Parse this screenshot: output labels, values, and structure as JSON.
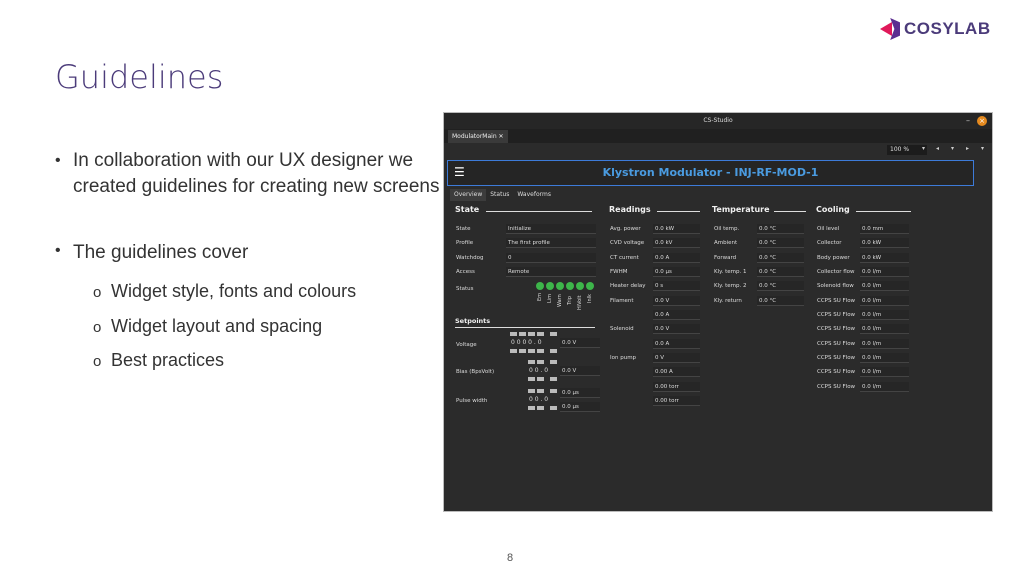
{
  "slide": {
    "title": "Guidelines",
    "logo_text": "COSYLAB",
    "page_number": "8",
    "bullets": [
      {
        "text": "In collaboration with our UX designer we created guidelines for creating new screens"
      },
      {
        "text": "The guidelines cover",
        "subs": [
          "Widget style, fonts and colours",
          "Widget layout and spacing",
          "Best practices"
        ]
      }
    ],
    "bullet_glyph": "•",
    "sub_glyph": "o"
  },
  "colors": {
    "title": "#4b3b7a",
    "accent": "#3d7bd9",
    "led": "#3db54a",
    "close": "#e58a1f"
  },
  "app": {
    "window_title": "CS-Studio",
    "minimize": "–",
    "close": "×",
    "tab": "ModulatorMain ✕",
    "zoom": "100 %",
    "toolbar_icons": [
      "▾",
      "◂",
      "▾",
      "▸",
      "▾"
    ],
    "header_title": "Klystron Modulator - INJ-RF-MOD-1",
    "menu_icon": "☰",
    "view_tabs": [
      "Overview",
      "Status",
      "Waveforms"
    ],
    "sections": {
      "state": "State",
      "readings": "Readings",
      "temperature": "Temperature",
      "cooling": "Cooling",
      "setpoints": "Setpoints"
    },
    "state": [
      {
        "label": "State",
        "value": "Initialize"
      },
      {
        "label": "Profile",
        "value": "The first profile"
      },
      {
        "label": "Watchdog",
        "value": "0"
      },
      {
        "label": "Access",
        "value": "Remote"
      },
      {
        "label": "Status",
        "value": ""
      }
    ],
    "status_leds": [
      "Em",
      "Lim",
      "Warn",
      "Trip",
      "HiVolt",
      "Inlk"
    ],
    "readings": [
      {
        "label": "Avg. power",
        "value": "0.0 kW"
      },
      {
        "label": "CVD voltage",
        "value": "0.0 kV"
      },
      {
        "label": "CT current",
        "value": "0.0 A"
      },
      {
        "label": "FWHM",
        "value": "0.0 µs"
      },
      {
        "label": "Heater delay",
        "value": "0 s"
      },
      {
        "label": "Filament",
        "value": "0.0 V"
      },
      {
        "label": "",
        "value": "0.0 A"
      },
      {
        "label": "Solenoid",
        "value": "0.0 V"
      },
      {
        "label": "",
        "value": "0.0 A"
      },
      {
        "label": "Ion pump",
        "value": "0 V"
      },
      {
        "label": "",
        "value": "0.00 A"
      },
      {
        "label": "",
        "value": "0.00 torr"
      },
      {
        "label": "",
        "value": "0.00 torr"
      }
    ],
    "temperature": [
      {
        "label": "Oil temp.",
        "value": "0.0 °C"
      },
      {
        "label": "Ambient",
        "value": "0.0 °C"
      },
      {
        "label": "Forward",
        "value": "0.0 °C"
      },
      {
        "label": "Kly. temp. 1",
        "value": "0.0 °C"
      },
      {
        "label": "Kly. temp. 2",
        "value": "0.0 °C"
      },
      {
        "label": "Kly. return",
        "value": "0.0 °C"
      }
    ],
    "cooling": [
      {
        "label": "Oil level",
        "value": "0.0 mm"
      },
      {
        "label": "Collector",
        "value": "0.0 kW"
      },
      {
        "label": "Body power",
        "value": "0.0 kW"
      },
      {
        "label": "Collector flow",
        "value": "0.0 l/m"
      },
      {
        "label": "Solenoid flow",
        "value": "0.0 l/m"
      },
      {
        "label": "CCPS SU Flow",
        "value": "0.0 l/m"
      },
      {
        "label": "CCPS SU Flow",
        "value": "0.0 l/m"
      },
      {
        "label": "CCPS SU Flow",
        "value": "0.0 l/m"
      },
      {
        "label": "CCPS SU Flow",
        "value": "0.0 l/m"
      },
      {
        "label": "CCPS SU Flow",
        "value": "0.0 l/m"
      },
      {
        "label": "CCPS SU Flow",
        "value": "0.0 l/m"
      },
      {
        "label": "CCPS SU Flow",
        "value": "0.0 l/m"
      }
    ],
    "setpoints": [
      {
        "label": "Voltage",
        "digits": "0 0 0 0 . 0",
        "value": "0.0 V"
      },
      {
        "label": "Bias (BpsVolt)",
        "digits": "0 0 . 0",
        "value": "0.0 V"
      },
      {
        "label": "Pulse width",
        "digits": "0 0 . 0",
        "value": "0.0 µs",
        "value2": "0.0 µs"
      }
    ]
  }
}
